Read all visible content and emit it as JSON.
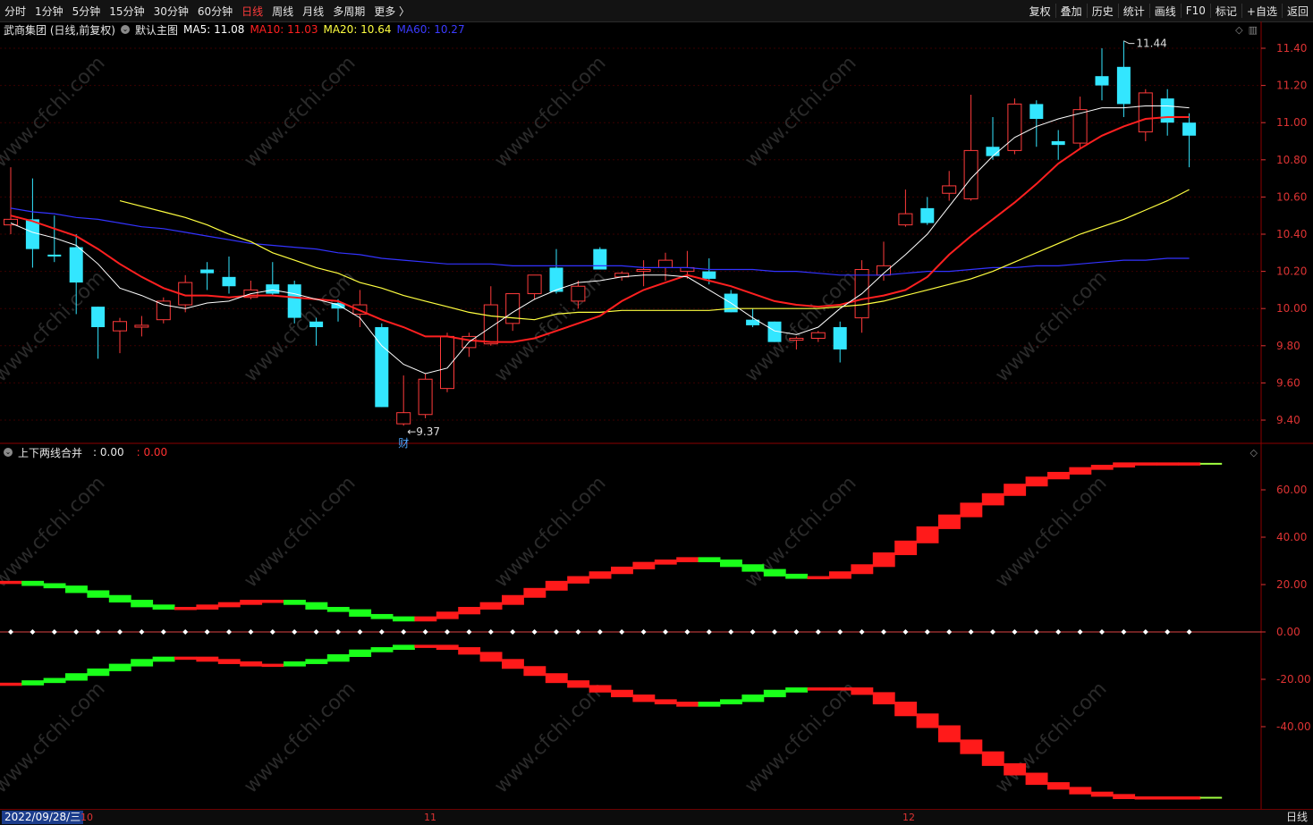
{
  "toolbar": {
    "periods": [
      "分时",
      "1分钟",
      "5分钟",
      "15分钟",
      "30分钟",
      "60分钟",
      "日线",
      "周线",
      "月线",
      "多周期",
      "更多 〉"
    ],
    "active_period": "日线",
    "tools": [
      "复权",
      "叠加",
      "历史",
      "统计",
      "画线",
      "F10",
      "标记",
      "+自选",
      "返回"
    ]
  },
  "main_pane": {
    "stock_title": "武商集团 (日线,前复权)",
    "template_label": "默认主图",
    "ma5": "MA5: 11.08",
    "ma10": "MA10: 11.03",
    "ma20": "MA20: 10.64",
    "ma60": "MA60: 10.27",
    "colors": {
      "ma5": "#ffffff",
      "ma10": "#ff2020",
      "ma20": "#ffff40",
      "ma60": "#3333ff",
      "up": "#ff3b3b",
      "down": "#33e6ff"
    },
    "high_marker": "11.44",
    "low_marker": "9.37",
    "event_badge": "财",
    "y_ticks": [
      "11.40",
      "11.20",
      "11.00",
      "10.80",
      "10.60",
      "10.40",
      "10.20",
      "10.00",
      "9.80",
      "9.60",
      "9.40"
    ]
  },
  "indicator_pane": {
    "name": "上下两线合并",
    "value1": ": 0.00",
    "value2": ": 0.00",
    "y_ticks": [
      "60.00",
      "40.00",
      "20.00",
      "0.00",
      "-20.00",
      "-40.00"
    ]
  },
  "bottom_bar": {
    "date": "2022/09/28/三",
    "month_ticks": [
      "10",
      "11",
      "12"
    ],
    "period": "日线"
  },
  "watermark": "www.cfchi.com",
  "chart_data": {
    "type": "candlestick",
    "ylim": [
      9.3,
      11.5
    ],
    "candles": [
      {
        "o": 10.45,
        "h": 10.76,
        "l": 10.4,
        "c": 10.48
      },
      {
        "o": 10.48,
        "h": 10.7,
        "l": 10.22,
        "c": 10.32
      },
      {
        "o": 10.29,
        "h": 10.5,
        "l": 10.25,
        "c": 10.28
      },
      {
        "o": 10.33,
        "h": 10.4,
        "l": 9.97,
        "c": 10.14
      },
      {
        "o": 10.01,
        "h": 10.01,
        "l": 9.73,
        "c": 9.9
      },
      {
        "o": 9.88,
        "h": 9.95,
        "l": 9.76,
        "c": 9.93
      },
      {
        "o": 9.9,
        "h": 9.96,
        "l": 9.85,
        "c": 9.91
      },
      {
        "o": 9.94,
        "h": 10.06,
        "l": 9.92,
        "c": 10.04
      },
      {
        "o": 10.02,
        "h": 10.18,
        "l": 9.98,
        "c": 10.14
      },
      {
        "o": 10.21,
        "h": 10.25,
        "l": 10.1,
        "c": 10.19
      },
      {
        "o": 10.17,
        "h": 10.28,
        "l": 10.08,
        "c": 10.12
      },
      {
        "o": 10.06,
        "h": 10.15,
        "l": 10.05,
        "c": 10.1
      },
      {
        "o": 10.13,
        "h": 10.25,
        "l": 10.07,
        "c": 10.08
      },
      {
        "o": 10.13,
        "h": 10.15,
        "l": 9.92,
        "c": 9.95
      },
      {
        "o": 9.93,
        "h": 9.95,
        "l": 9.8,
        "c": 9.9
      },
      {
        "o": 10.03,
        "h": 10.05,
        "l": 9.93,
        "c": 10.0
      },
      {
        "o": 9.97,
        "h": 10.1,
        "l": 9.9,
        "c": 10.02
      },
      {
        "o": 9.9,
        "h": 9.92,
        "l": 9.47,
        "c": 9.47
      },
      {
        "o": 9.38,
        "h": 9.64,
        "l": 9.37,
        "c": 9.44
      },
      {
        "o": 9.43,
        "h": 9.65,
        "l": 9.41,
        "c": 9.62
      },
      {
        "o": 9.57,
        "h": 9.87,
        "l": 9.55,
        "c": 9.85
      },
      {
        "o": 9.79,
        "h": 9.87,
        "l": 9.74,
        "c": 9.85
      },
      {
        "o": 9.81,
        "h": 10.12,
        "l": 9.8,
        "c": 10.02
      },
      {
        "o": 9.92,
        "h": 10.08,
        "l": 9.88,
        "c": 10.08
      },
      {
        "o": 10.08,
        "h": 10.15,
        "l": 10.05,
        "c": 10.18
      },
      {
        "o": 10.22,
        "h": 10.32,
        "l": 10.08,
        "c": 10.09
      },
      {
        "o": 10.04,
        "h": 10.15,
        "l": 10.0,
        "c": 10.12
      },
      {
        "o": 10.32,
        "h": 10.33,
        "l": 10.21,
        "c": 10.21
      },
      {
        "o": 10.17,
        "h": 10.2,
        "l": 10.15,
        "c": 10.19
      },
      {
        "o": 10.2,
        "h": 10.26,
        "l": 10.12,
        "c": 10.21
      },
      {
        "o": 10.22,
        "h": 10.3,
        "l": 10.15,
        "c": 10.26
      },
      {
        "o": 10.2,
        "h": 10.31,
        "l": 10.16,
        "c": 10.22
      },
      {
        "o": 10.2,
        "h": 10.27,
        "l": 10.13,
        "c": 10.16
      },
      {
        "o": 10.08,
        "h": 10.1,
        "l": 9.98,
        "c": 9.98
      },
      {
        "o": 9.94,
        "h": 10.0,
        "l": 9.9,
        "c": 9.91
      },
      {
        "o": 9.93,
        "h": 9.93,
        "l": 9.82,
        "c": 9.82
      },
      {
        "o": 9.83,
        "h": 9.85,
        "l": 9.78,
        "c": 9.84
      },
      {
        "o": 9.84,
        "h": 9.88,
        "l": 9.82,
        "c": 9.87
      },
      {
        "o": 9.9,
        "h": 9.93,
        "l": 9.71,
        "c": 9.78
      },
      {
        "o": 9.95,
        "h": 10.26,
        "l": 9.87,
        "c": 10.21
      },
      {
        "o": 10.18,
        "h": 10.36,
        "l": 10.15,
        "c": 10.23
      },
      {
        "o": 10.45,
        "h": 10.64,
        "l": 10.44,
        "c": 10.51
      },
      {
        "o": 10.54,
        "h": 10.6,
        "l": 10.45,
        "c": 10.46
      },
      {
        "o": 10.62,
        "h": 10.74,
        "l": 10.58,
        "c": 10.66
      },
      {
        "o": 10.59,
        "h": 11.15,
        "l": 10.58,
        "c": 10.85
      },
      {
        "o": 10.87,
        "h": 11.03,
        "l": 10.8,
        "c": 10.82
      },
      {
        "o": 10.85,
        "h": 11.13,
        "l": 10.83,
        "c": 11.1
      },
      {
        "o": 11.1,
        "h": 11.12,
        "l": 10.87,
        "c": 11.02
      },
      {
        "o": 10.9,
        "h": 10.96,
        "l": 10.8,
        "c": 10.88
      },
      {
        "o": 10.89,
        "h": 11.14,
        "l": 10.86,
        "c": 11.07
      },
      {
        "o": 11.25,
        "h": 11.4,
        "l": 11.12,
        "c": 11.2
      },
      {
        "o": 11.3,
        "h": 11.44,
        "l": 11.03,
        "c": 11.1
      },
      {
        "o": 10.95,
        "h": 11.18,
        "l": 10.9,
        "c": 11.16
      },
      {
        "o": 11.13,
        "h": 11.18,
        "l": 10.93,
        "c": 11.0
      },
      {
        "o": 11.0,
        "h": 11.05,
        "l": 10.76,
        "c": 10.93
      }
    ],
    "ma5": [
      10.46,
      10.41,
      10.38,
      10.34,
      10.24,
      10.11,
      10.07,
      10.02,
      10.0,
      10.03,
      10.04,
      10.08,
      10.1,
      10.08,
      10.05,
      10.02,
      9.95,
      9.8,
      9.7,
      9.65,
      9.68,
      9.82,
      9.9,
      9.98,
      10.05,
      10.1,
      10.14,
      10.15,
      10.17,
      10.18,
      10.18,
      10.17,
      10.1,
      10.03,
      9.95,
      9.88,
      9.86,
      9.9,
      10.0,
      10.08,
      10.19,
      10.29,
      10.4,
      10.55,
      10.7,
      10.82,
      10.92,
      10.98,
      11.02,
      11.05,
      11.08,
      11.08,
      11.09,
      11.09,
      11.08
    ],
    "ma10": [
      10.5,
      10.47,
      10.43,
      10.39,
      10.32,
      10.24,
      10.17,
      10.11,
      10.07,
      10.07,
      10.06,
      10.07,
      10.07,
      10.06,
      10.05,
      10.04,
      9.99,
      9.94,
      9.9,
      9.85,
      9.85,
      9.83,
      9.82,
      9.82,
      9.84,
      9.88,
      9.92,
      9.96,
      10.04,
      10.1,
      10.14,
      10.18,
      10.15,
      10.12,
      10.08,
      10.04,
      10.02,
      10.01,
      10.02,
      10.05,
      10.07,
      10.1,
      10.17,
      10.29,
      10.39,
      10.48,
      10.57,
      10.67,
      10.78,
      10.86,
      10.93,
      10.98,
      11.02,
      11.03,
      11.03
    ],
    "ma20": [
      10.58,
      10.55,
      10.52,
      10.49,
      10.45,
      10.4,
      10.36,
      10.3,
      10.26,
      10.22,
      10.19,
      10.14,
      10.11,
      10.07,
      10.04,
      10.01,
      9.98,
      9.96,
      9.95,
      9.94,
      9.97,
      9.98,
      9.98,
      9.99,
      9.99,
      9.99,
      9.99,
      9.99,
      10.0,
      10.0,
      10.0,
      10.0,
      10.0,
      10.01,
      10.02,
      10.04,
      10.07,
      10.1,
      10.13,
      10.16,
      10.2,
      10.25,
      10.3,
      10.35,
      10.4,
      10.44,
      10.48,
      10.53,
      10.58,
      10.64
    ],
    "ma60": [
      10.54,
      10.52,
      10.51,
      10.49,
      10.48,
      10.46,
      10.44,
      10.43,
      10.41,
      10.39,
      10.37,
      10.35,
      10.34,
      10.33,
      10.32,
      10.3,
      10.29,
      10.27,
      10.26,
      10.25,
      10.24,
      10.24,
      10.24,
      10.23,
      10.23,
      10.23,
      10.23,
      10.23,
      10.23,
      10.22,
      10.22,
      10.22,
      10.21,
      10.21,
      10.21,
      10.2,
      10.2,
      10.19,
      10.18,
      10.18,
      10.18,
      10.19,
      10.2,
      10.2,
      10.21,
      10.22,
      10.22,
      10.23,
      10.23,
      10.24,
      10.25,
      10.26,
      10.26,
      10.27,
      10.27
    ],
    "indicator": {
      "ylim": [
        -70,
        72
      ],
      "upper": [
        21,
        20,
        19,
        17,
        15,
        13,
        11,
        10,
        10,
        11,
        12,
        13,
        13,
        12,
        10,
        9,
        7,
        6,
        5,
        6,
        8,
        10,
        12,
        15,
        18,
        21,
        23,
        25,
        27,
        29,
        30,
        31,
        30,
        28,
        26,
        24,
        23,
        23,
        25,
        28,
        33,
        38,
        44,
        49,
        54,
        58,
        62,
        65,
        67,
        69,
        70,
        71,
        71,
        71,
        71
      ],
      "lower": [
        -22,
        -21,
        -20,
        -18,
        -16,
        -14,
        -12,
        -11,
        -11,
        -12,
        -13,
        -14,
        -14,
        -13,
        -12,
        -10,
        -8,
        -7,
        -6,
        -6,
        -7,
        -9,
        -12,
        -15,
        -18,
        -21,
        -23,
        -25,
        -27,
        -29,
        -30,
        -31,
        -30,
        -29,
        -27,
        -25,
        -24,
        -24,
        -24,
        -26,
        -30,
        -35,
        -40,
        -46,
        -51,
        -56,
        -60,
        -64,
        -66,
        -68,
        -69,
        -70,
        -70,
        -70,
        -70
      ]
    }
  }
}
